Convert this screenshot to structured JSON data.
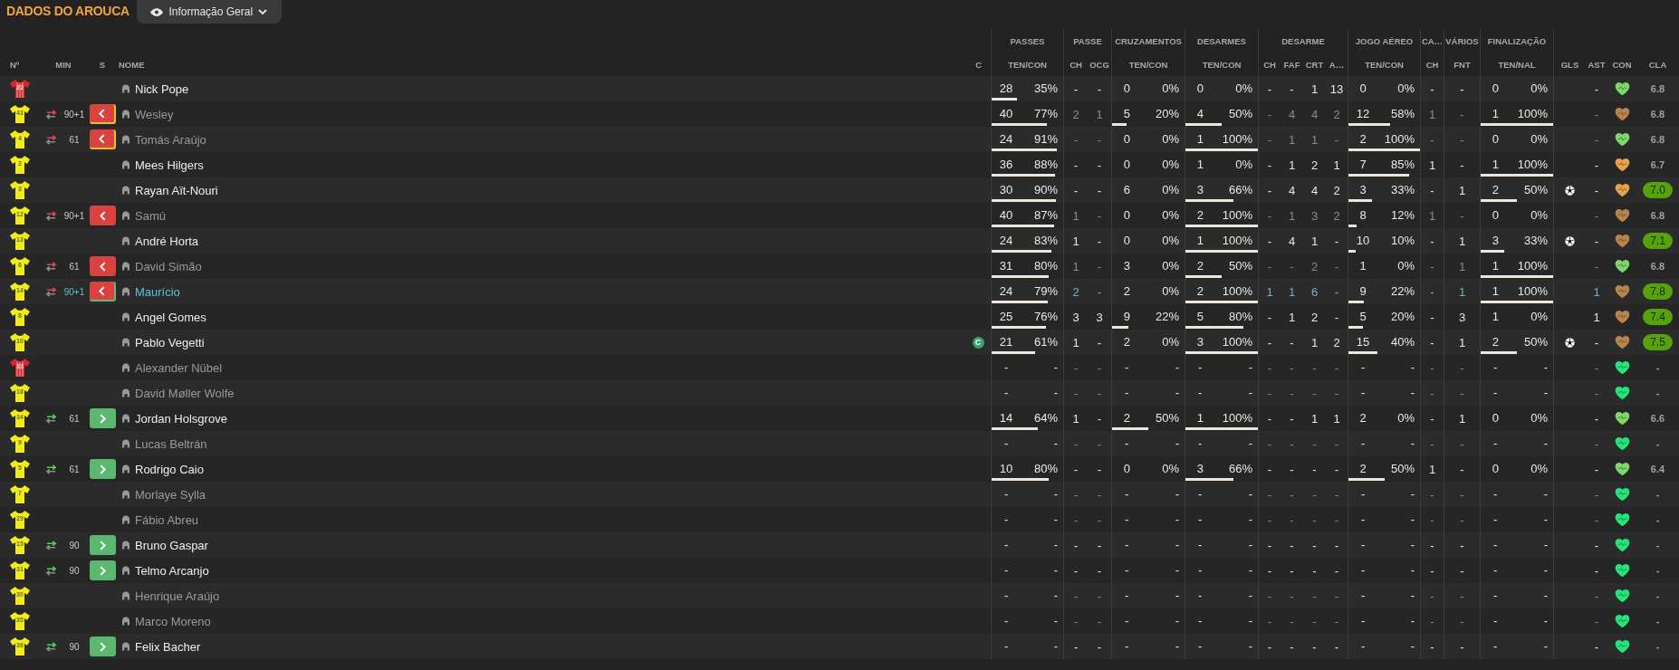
{
  "title": "DADOS DO AROUCA",
  "view_select": {
    "label": "Informação Geral"
  },
  "header": {
    "left": [
      "Nº",
      "MIN",
      "S",
      "NOME",
      "C"
    ],
    "groups": [
      {
        "label": "PASSES",
        "columns": [
          "TEN/CON"
        ]
      },
      {
        "label": "PASSE",
        "columns": [
          "CH",
          "OCG"
        ]
      },
      {
        "label": "CRUZAMENTOS",
        "columns": [
          "TEN/CON"
        ]
      },
      {
        "label": "DESARMES",
        "columns": [
          "TEN/CON"
        ]
      },
      {
        "label": "DESARME",
        "columns": [
          "CH",
          "FAF",
          "CRT",
          "A…"
        ]
      },
      {
        "label": "JOGO AÉREO",
        "columns": [
          "TEN/CON"
        ]
      },
      {
        "label": "CA…",
        "columns": [
          "CH"
        ]
      },
      {
        "label": "VÁRIOS",
        "columns": [
          "FNT"
        ]
      },
      {
        "label": "FINALIZAÇÃO",
        "columns": [
          "TEN/NAL"
        ]
      }
    ],
    "extra_columns": [
      "GLS",
      "AST",
      "CON",
      "CLA"
    ]
  },
  "rows": [
    {
      "number": "22",
      "kind": "gk",
      "name": "Nick Pope",
      "dimmed": false,
      "selected": false,
      "passes": {
        "ten": "28",
        "con": "35%",
        "level": 0.35
      },
      "passe_ch": "-",
      "passe_ocg": "-",
      "cruzamentos": {
        "ten": "0",
        "con": "0%"
      },
      "desarmes": {
        "ten": "0",
        "con": "0%"
      },
      "desarme": [
        "-",
        "-",
        "1",
        "13"
      ],
      "aereo": {
        "ten": "0",
        "con": "0%"
      },
      "ca_ch": "-",
      "varios_fnt": "-",
      "finalizacao": {
        "ten": "0",
        "con": "0%"
      },
      "goal": false,
      "ast": "-",
      "condition": {
        "color": "#7fd86a"
      },
      "cla": {
        "text": "6.8",
        "highlight": false
      }
    },
    {
      "number": "43",
      "kind": "outfield",
      "sub": {
        "kind": "off",
        "minute": "90+1",
        "color": "#e6c229"
      },
      "name": "Wesley",
      "dimmed": true,
      "selected": false,
      "passes": {
        "ten": "40",
        "con": "77%",
        "level": 0.77
      },
      "passe_ch": "2",
      "passe_ocg": "1",
      "cruzamentos": {
        "ten": "5",
        "con": "20%",
        "level": 0.2
      },
      "desarmes": {
        "ten": "4",
        "con": "50%",
        "level": 0.5
      },
      "desarme": [
        "-",
        "4",
        "4",
        "2"
      ],
      "aereo": {
        "ten": "12",
        "con": "58%",
        "level": 0.58
      },
      "ca_ch": "1",
      "varios_fnt": "-",
      "finalizacao": {
        "ten": "1",
        "con": "100%",
        "level": 1
      },
      "goal": false,
      "ast": "-",
      "condition": {
        "color": "#b8844c"
      },
      "cla": {
        "text": "6.8",
        "highlight": false
      }
    },
    {
      "number": "4",
      "kind": "outfield",
      "sub": {
        "kind": "off",
        "minute": "61",
        "color": "#e6c229"
      },
      "name": "Tomás Araújo",
      "dimmed": true,
      "selected": false,
      "passes": {
        "ten": "24",
        "con": "91%",
        "level": 0.91
      },
      "passe_ch": "-",
      "passe_ocg": "-",
      "cruzamentos": {
        "ten": "0",
        "con": "0%"
      },
      "desarmes": {
        "ten": "1",
        "con": "100%",
        "level": 1
      },
      "desarme": [
        "-",
        "1",
        "1",
        "-"
      ],
      "aereo": {
        "ten": "2",
        "con": "100%",
        "level": 1
      },
      "ca_ch": "-",
      "varios_fnt": "-",
      "finalizacao": {
        "ten": "0",
        "con": "0%"
      },
      "goal": false,
      "ast": "-",
      "condition": {
        "color": "#7fd86a"
      },
      "cla": {
        "text": "6.8",
        "highlight": false
      }
    },
    {
      "number": "2",
      "kind": "outfield",
      "name": "Mees Hilgers",
      "dimmed": false,
      "selected": false,
      "passes": {
        "ten": "36",
        "con": "88%",
        "level": 0.88
      },
      "passe_ch": "-",
      "passe_ocg": "-",
      "cruzamentos": {
        "ten": "0",
        "con": "0%"
      },
      "desarmes": {
        "ten": "1",
        "con": "0%"
      },
      "desarme": [
        "-",
        "1",
        "2",
        "1"
      ],
      "aereo": {
        "ten": "7",
        "con": "85%",
        "level": 0.85
      },
      "ca_ch": "1",
      "varios_fnt": "-",
      "finalizacao": {
        "ten": "1",
        "con": "100%",
        "level": 1
      },
      "goal": false,
      "ast": "-",
      "condition": {
        "color": "#e9a24a"
      },
      "cla": {
        "text": "6.7",
        "highlight": false
      }
    },
    {
      "number": "3",
      "kind": "outfield",
      "name": "Rayan Aït-Nouri",
      "dimmed": false,
      "selected": false,
      "passes": {
        "ten": "30",
        "con": "90%",
        "level": 0.9
      },
      "passe_ch": "-",
      "passe_ocg": "-",
      "cruzamentos": {
        "ten": "6",
        "con": "0%"
      },
      "desarmes": {
        "ten": "3",
        "con": "66%",
        "level": 0.66
      },
      "desarme": [
        "-",
        "4",
        "4",
        "2"
      ],
      "aereo": {
        "ten": "3",
        "con": "33%",
        "level": 0.33
      },
      "ca_ch": "-",
      "varios_fnt": "1",
      "finalizacao": {
        "ten": "2",
        "con": "50%",
        "level": 0.5
      },
      "goal": true,
      "ast": "-",
      "condition": {
        "color": "#e9a24a"
      },
      "cla": {
        "text": "7.0",
        "highlight": true
      }
    },
    {
      "number": "12",
      "kind": "outfield",
      "sub": {
        "kind": "off",
        "minute": "90+1"
      },
      "name": "Samú",
      "dimmed": true,
      "selected": false,
      "passes": {
        "ten": "40",
        "con": "87%",
        "level": 0.87
      },
      "passe_ch": "1",
      "passe_ocg": "-",
      "cruzamentos": {
        "ten": "0",
        "con": "0%"
      },
      "desarmes": {
        "ten": "2",
        "con": "100%",
        "level": 1
      },
      "desarme": [
        "-",
        "1",
        "3",
        "2"
      ],
      "aereo": {
        "ten": "8",
        "con": "12%",
        "level": 0.12
      },
      "ca_ch": "1",
      "varios_fnt": "-",
      "finalizacao": {
        "ten": "0",
        "con": "0%"
      },
      "goal": false,
      "ast": "-",
      "condition": {
        "color": "#b8844c"
      },
      "cla": {
        "text": "6.8",
        "highlight": false
      }
    },
    {
      "number": "13",
      "kind": "outfield",
      "name": "André Horta",
      "dimmed": false,
      "selected": false,
      "passes": {
        "ten": "24",
        "con": "83%",
        "level": 0.83
      },
      "passe_ch": "1",
      "passe_ocg": "-",
      "cruzamentos": {
        "ten": "0",
        "con": "0%"
      },
      "desarmes": {
        "ten": "1",
        "con": "100%",
        "level": 1
      },
      "desarme": [
        "-",
        "4",
        "1",
        "-"
      ],
      "aereo": {
        "ten": "10",
        "con": "10%",
        "level": 0.1
      },
      "ca_ch": "-",
      "varios_fnt": "1",
      "finalizacao": {
        "ten": "3",
        "con": "33%",
        "level": 0.33
      },
      "goal": true,
      "ast": "-",
      "condition": {
        "color": "#b8844c"
      },
      "cla": {
        "text": "7.1",
        "highlight": true
      }
    },
    {
      "number": "6",
      "kind": "outfield",
      "sub": {
        "kind": "off",
        "minute": "61"
      },
      "name": "David Simão",
      "dimmed": true,
      "selected": false,
      "passes": {
        "ten": "31",
        "con": "80%",
        "level": 0.8
      },
      "passe_ch": "1",
      "passe_ocg": "-",
      "cruzamentos": {
        "ten": "3",
        "con": "0%"
      },
      "desarmes": {
        "ten": "2",
        "con": "50%",
        "level": 0.5
      },
      "desarme": [
        "-",
        "-",
        "2",
        "-"
      ],
      "aereo": {
        "ten": "1",
        "con": "0%"
      },
      "ca_ch": "-",
      "varios_fnt": "1",
      "finalizacao": {
        "ten": "1",
        "con": "100%",
        "level": 1
      },
      "goal": false,
      "ast": "-",
      "condition": {
        "color": "#7fd86a"
      },
      "cla": {
        "text": "6.8",
        "highlight": false
      }
    },
    {
      "number": "14",
      "kind": "outfield",
      "sub": {
        "kind": "off",
        "minute": "90+1",
        "color": "#5fb87a"
      },
      "name": "Maurício",
      "dimmed": false,
      "selected": true,
      "passes": {
        "ten": "24",
        "con": "79%",
        "level": 0.79
      },
      "passe_ch": "2",
      "passe_ocg": "-",
      "cruzamentos": {
        "ten": "2",
        "con": "0%"
      },
      "desarmes": {
        "ten": "2",
        "con": "100%",
        "level": 1
      },
      "desarme": [
        "1",
        "1",
        "6",
        "-"
      ],
      "aereo": {
        "ten": "9",
        "con": "22%",
        "level": 0.22
      },
      "ca_ch": "-",
      "varios_fnt": "1",
      "finalizacao": {
        "ten": "1",
        "con": "100%",
        "level": 1
      },
      "goal": false,
      "ast": "1",
      "condition": {
        "color": "#b8844c"
      },
      "cla": {
        "text": "7.8",
        "highlight": true
      }
    },
    {
      "number": "8",
      "kind": "outfield",
      "name": "Angel Gomes",
      "dimmed": false,
      "selected": false,
      "passes": {
        "ten": "25",
        "con": "76%",
        "level": 0.76
      },
      "passe_ch": "3",
      "passe_ocg": "3",
      "cruzamentos": {
        "ten": "9",
        "con": "22%",
        "level": 0.22
      },
      "desarmes": {
        "ten": "5",
        "con": "80%",
        "level": 0.8
      },
      "desarme": [
        "-",
        "1",
        "2",
        "-"
      ],
      "aereo": {
        "ten": "5",
        "con": "20%",
        "level": 0.2
      },
      "ca_ch": "-",
      "varios_fnt": "3",
      "finalizacao": {
        "ten": "1",
        "con": "0%"
      },
      "goal": false,
      "ast": "1",
      "condition": {
        "color": "#b8844c"
      },
      "cla": {
        "text": "7.4",
        "highlight": true
      }
    },
    {
      "number": "10",
      "kind": "outfield",
      "captain": "C",
      "name": "Pablo Vegetti",
      "dimmed": false,
      "selected": false,
      "passes": {
        "ten": "21",
        "con": "61%",
        "level": 0.61
      },
      "passe_ch": "1",
      "passe_ocg": "-",
      "cruzamentos": {
        "ten": "2",
        "con": "0%"
      },
      "desarmes": {
        "ten": "3",
        "con": "100%",
        "level": 1
      },
      "desarme": [
        "-",
        "-",
        "1",
        "2"
      ],
      "aereo": {
        "ten": "15",
        "con": "40%",
        "level": 0.4
      },
      "ca_ch": "-",
      "varios_fnt": "1",
      "finalizacao": {
        "ten": "2",
        "con": "50%",
        "level": 0.5
      },
      "goal": true,
      "ast": "-",
      "condition": {
        "color": "#b8844c"
      },
      "cla": {
        "text": "7.5",
        "highlight": true
      }
    },
    {
      "number": "33",
      "kind": "gk",
      "name": "Alexander Nübel",
      "dimmed": true,
      "selected": false,
      "passes": {
        "ten": "-",
        "con": "-"
      },
      "passe_ch": "-",
      "passe_ocg": "-",
      "cruzamentos": {
        "ten": "-",
        "con": "-"
      },
      "desarmes": {
        "ten": "-",
        "con": "-"
      },
      "desarme": [
        "-",
        "-",
        "-",
        "-"
      ],
      "aereo": {
        "ten": "-",
        "con": "-"
      },
      "ca_ch": "-",
      "varios_fnt": "-",
      "finalizacao": {
        "ten": "-",
        "con": "-"
      },
      "goal": false,
      "ast": "-",
      "condition": {
        "color": "#22e67a"
      },
      "cla": {
        "text": "-",
        "highlight": false
      }
    },
    {
      "number": "18",
      "kind": "outfield",
      "name": "David Møller Wolfe",
      "dimmed": true,
      "selected": false,
      "passes": {
        "ten": "-",
        "con": "-"
      },
      "passe_ch": "-",
      "passe_ocg": "-",
      "cruzamentos": {
        "ten": "-",
        "con": "-"
      },
      "desarmes": {
        "ten": "-",
        "con": "-"
      },
      "desarme": [
        "-",
        "-",
        "-",
        "-"
      ],
      "aereo": {
        "ten": "-",
        "con": "-"
      },
      "ca_ch": "-",
      "varios_fnt": "-",
      "finalizacao": {
        "ten": "-",
        "con": "-"
      },
      "goal": false,
      "ast": "-",
      "condition": {
        "color": "#22e67a"
      },
      "cla": {
        "text": "-",
        "highlight": false
      }
    },
    {
      "number": "34",
      "kind": "outfield",
      "sub": {
        "kind": "on",
        "minute": "61"
      },
      "name": "Jordan Holsgrove",
      "dimmed": false,
      "selected": false,
      "passes": {
        "ten": "14",
        "con": "64%",
        "level": 0.64
      },
      "passe_ch": "1",
      "passe_ocg": "-",
      "cruzamentos": {
        "ten": "2",
        "con": "50%",
        "level": 0.5
      },
      "desarmes": {
        "ten": "1",
        "con": "100%",
        "level": 1
      },
      "desarme": [
        "-",
        "-",
        "1",
        "1"
      ],
      "aereo": {
        "ten": "2",
        "con": "0%"
      },
      "ca_ch": "-",
      "varios_fnt": "1",
      "finalizacao": {
        "ten": "0",
        "con": "0%"
      },
      "goal": false,
      "ast": "-",
      "condition": {
        "color": "#7fd86a"
      },
      "cla": {
        "text": "6.6",
        "highlight": false
      }
    },
    {
      "number": "9",
      "kind": "outfield",
      "name": "Lucas Beltrán",
      "dimmed": true,
      "selected": false,
      "passes": {
        "ten": "-",
        "con": "-"
      },
      "passe_ch": "-",
      "passe_ocg": "-",
      "cruzamentos": {
        "ten": "-",
        "con": "-"
      },
      "desarmes": {
        "ten": "-",
        "con": "-"
      },
      "desarme": [
        "-",
        "-",
        "-",
        "-"
      ],
      "aereo": {
        "ten": "-",
        "con": "-"
      },
      "ca_ch": "-",
      "varios_fnt": "-",
      "finalizacao": {
        "ten": "-",
        "con": "-"
      },
      "goal": false,
      "ast": "-",
      "condition": {
        "color": "#22e67a"
      },
      "cla": {
        "text": "-",
        "highlight": false
      }
    },
    {
      "number": "5",
      "kind": "outfield",
      "sub": {
        "kind": "on",
        "minute": "61"
      },
      "name": "Rodrigo Caio",
      "dimmed": false,
      "selected": false,
      "passes": {
        "ten": "10",
        "con": "80%",
        "level": 0.8
      },
      "passe_ch": "-",
      "passe_ocg": "-",
      "cruzamentos": {
        "ten": "0",
        "con": "0%"
      },
      "desarmes": {
        "ten": "3",
        "con": "66%",
        "level": 0.66
      },
      "desarme": [
        "-",
        "-",
        "-",
        "-"
      ],
      "aereo": {
        "ten": "2",
        "con": "50%",
        "level": 0.5
      },
      "ca_ch": "1",
      "varios_fnt": "-",
      "finalizacao": {
        "ten": "0",
        "con": "0%"
      },
      "goal": false,
      "ast": "-",
      "condition": {
        "color": "#7fd86a"
      },
      "cla": {
        "text": "6.4",
        "highlight": false
      }
    },
    {
      "number": "7",
      "kind": "outfield",
      "name": "Morlaye Sylla",
      "dimmed": true,
      "selected": false,
      "passes": {
        "ten": "-",
        "con": "-"
      },
      "passe_ch": "-",
      "passe_ocg": "-",
      "cruzamentos": {
        "ten": "-",
        "con": "-"
      },
      "desarmes": {
        "ten": "-",
        "con": "-"
      },
      "desarme": [
        "-",
        "-",
        "-",
        "-"
      ],
      "aereo": {
        "ten": "-",
        "con": "-"
      },
      "ca_ch": "-",
      "varios_fnt": "-",
      "finalizacao": {
        "ten": "-",
        "con": "-"
      },
      "goal": false,
      "ast": "-",
      "condition": {
        "color": "#22e67a"
      },
      "cla": {
        "text": "-",
        "highlight": false
      }
    },
    {
      "number": "29",
      "kind": "outfield",
      "name": "Fábio Abreu",
      "dimmed": true,
      "selected": false,
      "passes": {
        "ten": "-",
        "con": "-"
      },
      "passe_ch": "-",
      "passe_ocg": "-",
      "cruzamentos": {
        "ten": "-",
        "con": "-"
      },
      "desarmes": {
        "ten": "-",
        "con": "-"
      },
      "desarme": [
        "-",
        "-",
        "-",
        "-"
      ],
      "aereo": {
        "ten": "-",
        "con": "-"
      },
      "ca_ch": "-",
      "varios_fnt": "-",
      "finalizacao": {
        "ten": "-",
        "con": "-"
      },
      "goal": false,
      "ast": "-",
      "condition": {
        "color": "#22e67a"
      },
      "cla": {
        "text": "-",
        "highlight": false
      }
    },
    {
      "number": "15",
      "kind": "outfield",
      "sub": {
        "kind": "on",
        "minute": "90"
      },
      "name": "Bruno Gaspar",
      "dimmed": false,
      "selected": false,
      "passes": {
        "ten": "-",
        "con": "-"
      },
      "passe_ch": "-",
      "passe_ocg": "-",
      "cruzamentos": {
        "ten": "-",
        "con": "-"
      },
      "desarmes": {
        "ten": "-",
        "con": "-"
      },
      "desarme": [
        "-",
        "-",
        "-",
        "-"
      ],
      "aereo": {
        "ten": "-",
        "con": "-"
      },
      "ca_ch": "-",
      "varios_fnt": "-",
      "finalizacao": {
        "ten": "-",
        "con": "-"
      },
      "goal": false,
      "ast": "-",
      "condition": {
        "color": "#22e67a"
      },
      "cla": {
        "text": "-",
        "highlight": false
      }
    },
    {
      "number": "31",
      "kind": "outfield",
      "sub": {
        "kind": "on",
        "minute": "90"
      },
      "name": "Telmo Arcanjo",
      "dimmed": false,
      "selected": false,
      "passes": {
        "ten": "-",
        "con": "-"
      },
      "passe_ch": "-",
      "passe_ocg": "-",
      "cruzamentos": {
        "ten": "-",
        "con": "-"
      },
      "desarmes": {
        "ten": "-",
        "con": "-"
      },
      "desarme": [
        "-",
        "-",
        "-",
        "-"
      ],
      "aereo": {
        "ten": "-",
        "con": "-"
      },
      "ca_ch": "-",
      "varios_fnt": "-",
      "finalizacao": {
        "ten": "-",
        "con": "-"
      },
      "goal": false,
      "ast": "-",
      "condition": {
        "color": "#22e67a"
      },
      "cla": {
        "text": "-",
        "highlight": false
      }
    },
    {
      "number": "30",
      "kind": "outfield",
      "name": "Henrique Araújo",
      "dimmed": true,
      "selected": false,
      "passes": {
        "ten": "-",
        "con": "-"
      },
      "passe_ch": "-",
      "passe_ocg": "-",
      "cruzamentos": {
        "ten": "-",
        "con": "-"
      },
      "desarmes": {
        "ten": "-",
        "con": "-"
      },
      "desarme": [
        "-",
        "-",
        "-",
        "-"
      ],
      "aereo": {
        "ten": "-",
        "con": "-"
      },
      "ca_ch": "-",
      "varios_fnt": "-",
      "finalizacao": {
        "ten": "-",
        "con": "-"
      },
      "goal": false,
      "ast": "-",
      "condition": {
        "color": "#22e67a"
      },
      "cla": {
        "text": "-",
        "highlight": false
      }
    },
    {
      "number": "35",
      "kind": "outfield",
      "name": "Marco Moreno",
      "dimmed": true,
      "selected": false,
      "passes": {
        "ten": "-",
        "con": "-"
      },
      "passe_ch": "-",
      "passe_ocg": "-",
      "cruzamentos": {
        "ten": "-",
        "con": "-"
      },
      "desarmes": {
        "ten": "-",
        "con": "-"
      },
      "desarme": [
        "-",
        "-",
        "-",
        "-"
      ],
      "aereo": {
        "ten": "-",
        "con": "-"
      },
      "ca_ch": "-",
      "varios_fnt": "-",
      "finalizacao": {
        "ten": "-",
        "con": "-"
      },
      "goal": false,
      "ast": "-",
      "condition": {
        "color": "#22e67a"
      },
      "cla": {
        "text": "-",
        "highlight": false
      }
    },
    {
      "number": "36",
      "kind": "outfield",
      "sub": {
        "kind": "on",
        "minute": "90"
      },
      "name": "Felix Bacher",
      "dimmed": false,
      "selected": false,
      "passes": {
        "ten": "-",
        "con": "-"
      },
      "passe_ch": "-",
      "passe_ocg": "-",
      "cruzamentos": {
        "ten": "-",
        "con": "-"
      },
      "desarmes": {
        "ten": "-",
        "con": "-"
      },
      "desarme": [
        "-",
        "-",
        "-",
        "-"
      ],
      "aereo": {
        "ten": "-",
        "con": "-"
      },
      "ca_ch": "-",
      "varios_fnt": "-",
      "finalizacao": {
        "ten": "-",
        "con": "-"
      },
      "goal": false,
      "ast": "-",
      "condition": {
        "color": "#22e67a"
      },
      "cla": {
        "text": "-",
        "highlight": false
      }
    }
  ]
}
